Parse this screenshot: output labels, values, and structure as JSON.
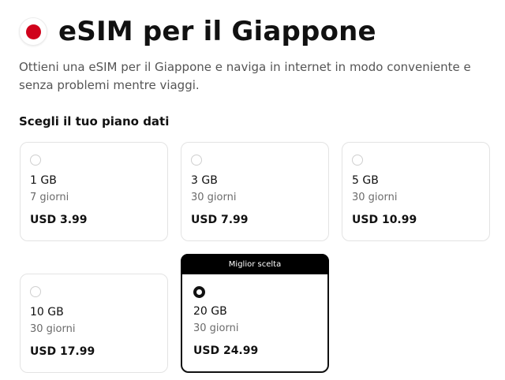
{
  "header": {
    "flag_icon": "japan-flag-icon",
    "flag_color": "#d0021b",
    "title": "eSIM per il Giappone"
  },
  "subtitle": "Ottieni una eSIM per il Giappone e naviga in internet in modo conveniente e senza problemi mentre viaggi.",
  "section_label": "Scegli il tuo piano dati",
  "plans": [
    {
      "data": "1 GB",
      "days": "7 giorni",
      "price": "USD 3.99",
      "selected": false
    },
    {
      "data": "3 GB",
      "days": "30 giorni",
      "price": "USD 7.99",
      "selected": false
    },
    {
      "data": "5 GB",
      "days": "30 giorni",
      "price": "USD 10.99",
      "selected": false
    },
    {
      "data": "10 GB",
      "days": "30 giorni",
      "price": "USD 17.99",
      "selected": false
    },
    {
      "data": "20 GB",
      "days": "30 giorni",
      "price": "USD 24.99",
      "selected": true,
      "badge": "Miglior scelta"
    }
  ]
}
